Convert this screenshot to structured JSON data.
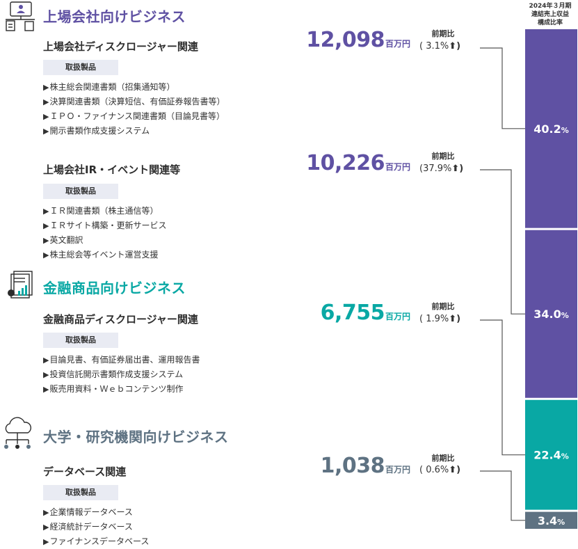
{
  "column_header": [
    "2024年３月期",
    "連結売上収益",
    "構成比率"
  ],
  "yoy_label": "前期比",
  "unit": "百万円",
  "badge_label": "取扱製品",
  "colors": {
    "purple": "#5f51a3",
    "teal": "#09a8a4",
    "slate": "#5e7282",
    "connector": "#555555"
  },
  "sections": [
    {
      "title": "上場会社向けビジネス",
      "icon": "monitor-person-icon",
      "color": "#5f51a3"
    },
    {
      "title": "金融商品向けビジネス",
      "icon": "document-chart-icon",
      "color": "#09a8a4"
    },
    {
      "title": "大学・研究機関向けビジネス",
      "icon": "cloud-network-icon",
      "color": "#5e7282"
    }
  ],
  "categories": [
    {
      "name": "上場会社ディスクロージャー関連",
      "amount": "12,098",
      "yoy": "(  3.1%",
      "products": [
        "株主総会関連書類（招集通知等）",
        "決算関連書類（決算短信、有価証券報告書等）",
        "ＩＰＯ・ファイナンス関連書類（目論見書等）",
        "開示書類作成支援システム"
      ]
    },
    {
      "name": "上場会社IR・イベント関連等",
      "amount": "10,226",
      "yoy": "(37.9%",
      "products": [
        "ＩＲ関連書類（株主通信等）",
        "ＩＲサイト構築・更新サービス",
        "英文翻訳",
        "株主総会等イベント運営支援"
      ]
    },
    {
      "name": "金融商品ディスクロージャー関連",
      "amount": "6,755",
      "yoy": "(  1.9%",
      "products": [
        "目論見書、有価証券届出書、運用報告書",
        "投資信託開示書類作成支援システム",
        "販売用資料・Ｗｅｂコンテンツ制作"
      ]
    },
    {
      "name": "データベース関連",
      "amount": "1,038",
      "yoy": "(  0.6%",
      "products": [
        "企業情報データベース",
        "経済統計データベース",
        "ファイナンスデータベース"
      ]
    }
  ],
  "chart_data": {
    "type": "bar",
    "stacked": true,
    "title": "2024年３月期 連結売上収益 構成比率",
    "categories": [
      "上場会社ディスクロージャー関連",
      "上場会社IR・イベント関連等",
      "金融商品ディスクロージャー関連",
      "データベース関連"
    ],
    "values": [
      40.2,
      34.0,
      22.4,
      3.4
    ],
    "value_labels": [
      "40.2",
      "34.0",
      "22.4",
      "3.4"
    ],
    "value_unit": "%",
    "colors": [
      "#5f51a3",
      "#5f51a3",
      "#09a8a4",
      "#5e7282"
    ],
    "amounts": [
      12098,
      10226,
      6755,
      1038
    ],
    "amount_unit": "百万円",
    "yoy_change_percent": [
      3.1,
      37.9,
      1.9,
      0.6
    ],
    "yoy_direction": [
      "up",
      "up",
      "up",
      "up"
    ]
  }
}
